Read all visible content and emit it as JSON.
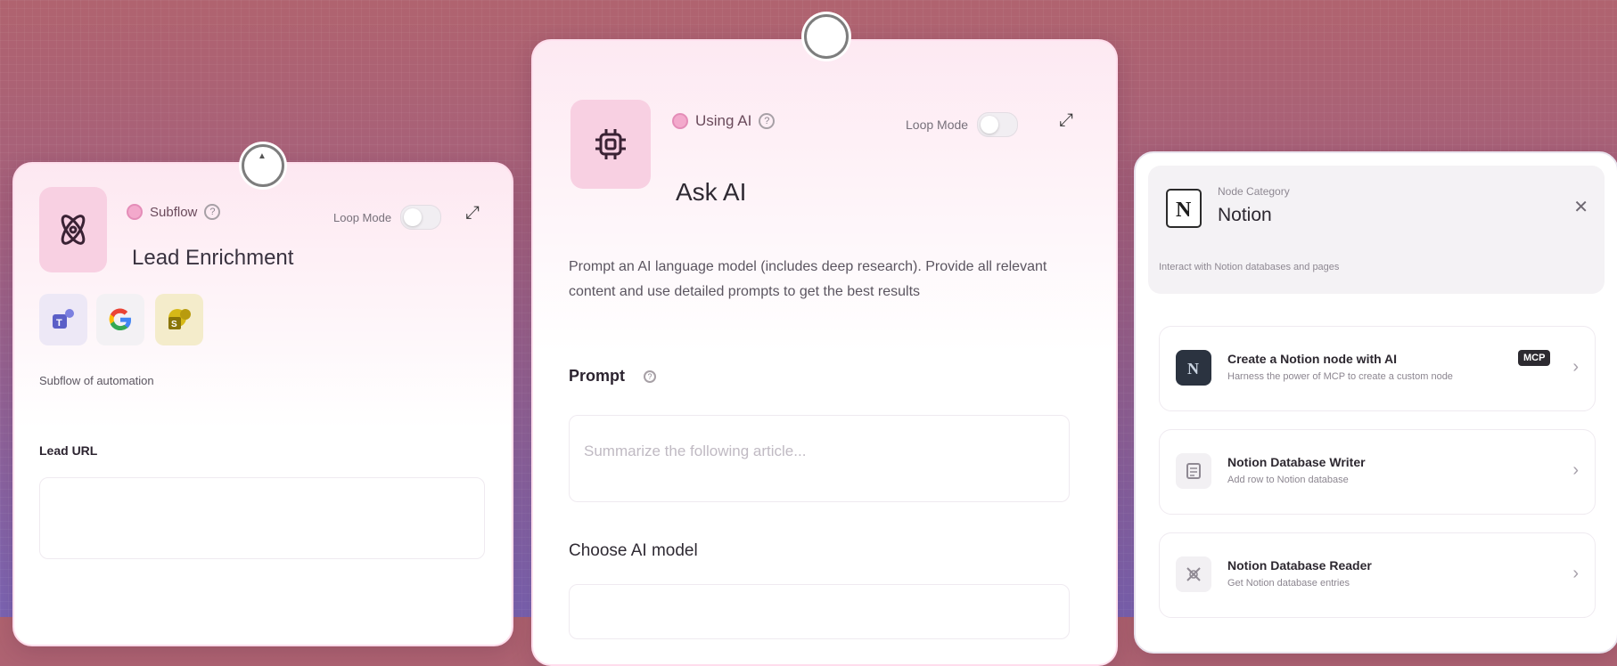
{
  "left_node": {
    "tag": "Subflow",
    "title": "Lead Enrichment",
    "loop_label": "Loop Mode",
    "description": "Subflow of automation",
    "field_label": "Lead URL",
    "apps": [
      "teams-icon",
      "google-icon",
      "sharepoint-icon"
    ]
  },
  "mid_node": {
    "tag": "Using AI",
    "title": "Ask AI",
    "loop_label": "Loop Mode",
    "description": "Prompt an AI language model (includes deep research). Provide all relevant content and use detailed prompts to get the best results",
    "prompt_label": "Prompt",
    "prompt_placeholder": "Summarize the following article...",
    "model_label": "Choose AI model"
  },
  "right_panel": {
    "category_caption": "Node Category",
    "category_title": "Notion",
    "category_desc": "Interact with Notion databases and pages",
    "items": [
      {
        "title": "Create a Notion node with AI",
        "subtitle": "Harness the power of MCP to create a custom node",
        "badge": "MCP"
      },
      {
        "title": "Notion Database Writer",
        "subtitle": "Add row to Notion database"
      },
      {
        "title": "Notion Database Reader",
        "subtitle": "Get Notion database entries"
      }
    ]
  },
  "colors": {
    "accent_pink": "#f8d0e2",
    "notion_dark": "#2b3340"
  }
}
